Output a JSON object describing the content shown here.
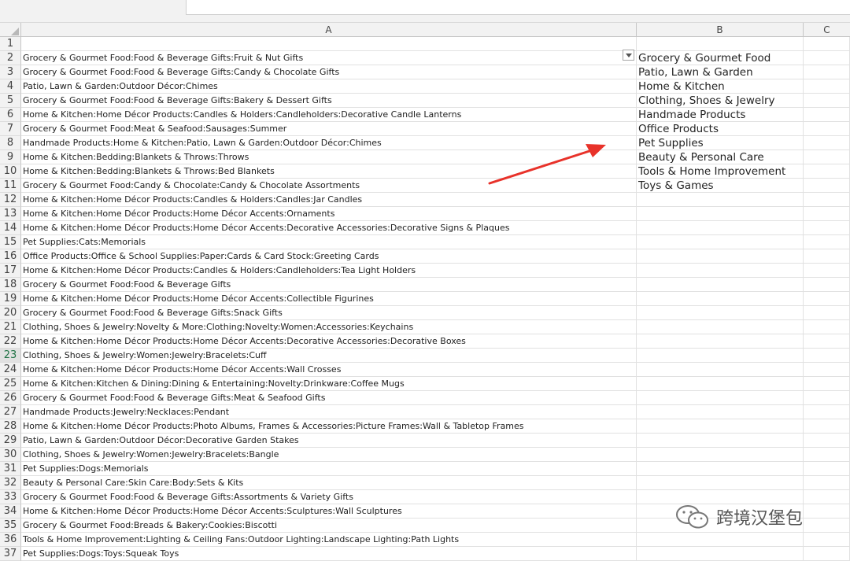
{
  "columns": [
    {
      "label": "A"
    },
    {
      "label": "B"
    },
    {
      "label": "C"
    }
  ],
  "active_row": 23,
  "rows": [
    {
      "n": "1",
      "a": "",
      "b": ""
    },
    {
      "n": "2",
      "a": "Grocery & Gourmet Food:Food & Beverage Gifts:Fruit & Nut Gifts",
      "b": "Grocery & Gourmet Food"
    },
    {
      "n": "3",
      "a": "Grocery & Gourmet Food:Food & Beverage Gifts:Candy & Chocolate Gifts",
      "b": "Patio, Lawn & Garden"
    },
    {
      "n": "4",
      "a": "Patio, Lawn & Garden:Outdoor Décor:Chimes",
      "b": "Home & Kitchen"
    },
    {
      "n": "5",
      "a": "Grocery & Gourmet Food:Food & Beverage Gifts:Bakery & Dessert Gifts",
      "b": "Clothing, Shoes & Jewelry"
    },
    {
      "n": "6",
      "a": "Home & Kitchen:Home Décor Products:Candles & Holders:Candleholders:Decorative Candle Lanterns",
      "b": "Handmade Products"
    },
    {
      "n": "7",
      "a": "Grocery & Gourmet Food:Meat & Seafood:Sausages:Summer",
      "b": "Office Products"
    },
    {
      "n": "8",
      "a": "Handmade Products:Home & Kitchen:Patio, Lawn & Garden:Outdoor Décor:Chimes",
      "b": "Pet Supplies"
    },
    {
      "n": "9",
      "a": "Home & Kitchen:Bedding:Blankets & Throws:Throws",
      "b": "Beauty & Personal Care"
    },
    {
      "n": "10",
      "a": "Home & Kitchen:Bedding:Blankets & Throws:Bed Blankets",
      "b": "Tools & Home Improvement"
    },
    {
      "n": "11",
      "a": "Grocery & Gourmet Food:Candy & Chocolate:Candy & Chocolate Assortments",
      "b": "Toys & Games"
    },
    {
      "n": "12",
      "a": "Home & Kitchen:Home Décor Products:Candles & Holders:Candles:Jar Candles",
      "b": ""
    },
    {
      "n": "13",
      "a": "Home & Kitchen:Home Décor Products:Home Décor Accents:Ornaments",
      "b": ""
    },
    {
      "n": "14",
      "a": "Home & Kitchen:Home Décor Products:Home Décor Accents:Decorative Accessories:Decorative Signs & Plaques",
      "b": ""
    },
    {
      "n": "15",
      "a": "Pet Supplies:Cats:Memorials",
      "b": ""
    },
    {
      "n": "16",
      "a": "Office Products:Office & School Supplies:Paper:Cards & Card Stock:Greeting Cards",
      "b": ""
    },
    {
      "n": "17",
      "a": "Home & Kitchen:Home Décor Products:Candles & Holders:Candleholders:Tea Light Holders",
      "b": ""
    },
    {
      "n": "18",
      "a": "Grocery & Gourmet Food:Food & Beverage Gifts",
      "b": ""
    },
    {
      "n": "19",
      "a": "Home & Kitchen:Home Décor Products:Home Décor Accents:Collectible Figurines",
      "b": ""
    },
    {
      "n": "20",
      "a": "Grocery & Gourmet Food:Food & Beverage Gifts:Snack Gifts",
      "b": ""
    },
    {
      "n": "21",
      "a": "Clothing, Shoes & Jewelry:Novelty & More:Clothing:Novelty:Women:Accessories:Keychains",
      "b": ""
    },
    {
      "n": "22",
      "a": "Home & Kitchen:Home Décor Products:Home Décor Accents:Decorative Accessories:Decorative Boxes",
      "b": ""
    },
    {
      "n": "23",
      "a": "Clothing, Shoes & Jewelry:Women:Jewelry:Bracelets:Cuff",
      "b": ""
    },
    {
      "n": "24",
      "a": "Home & Kitchen:Home Décor Products:Home Décor Accents:Wall Crosses",
      "b": ""
    },
    {
      "n": "25",
      "a": "Home & Kitchen:Kitchen & Dining:Dining & Entertaining:Novelty:Drinkware:Coffee Mugs",
      "b": ""
    },
    {
      "n": "26",
      "a": "Grocery & Gourmet Food:Food & Beverage Gifts:Meat & Seafood Gifts",
      "b": ""
    },
    {
      "n": "27",
      "a": "Handmade Products:Jewelry:Necklaces:Pendant",
      "b": ""
    },
    {
      "n": "28",
      "a": "Home & Kitchen:Home Décor Products:Photo Albums, Frames & Accessories:Picture Frames:Wall & Tabletop Frames",
      "b": ""
    },
    {
      "n": "29",
      "a": "Patio, Lawn & Garden:Outdoor Décor:Decorative Garden Stakes",
      "b": ""
    },
    {
      "n": "30",
      "a": "Clothing, Shoes & Jewelry:Women:Jewelry:Bracelets:Bangle",
      "b": ""
    },
    {
      "n": "31",
      "a": "Pet Supplies:Dogs:Memorials",
      "b": ""
    },
    {
      "n": "32",
      "a": "Beauty & Personal Care:Skin Care:Body:Sets & Kits",
      "b": ""
    },
    {
      "n": "33",
      "a": "Grocery & Gourmet Food:Food & Beverage Gifts:Assortments & Variety Gifts",
      "b": ""
    },
    {
      "n": "34",
      "a": "Home & Kitchen:Home Décor Products:Home Décor Accents:Sculptures:Wall Sculptures",
      "b": ""
    },
    {
      "n": "35",
      "a": "Grocery & Gourmet Food:Breads & Bakery:Cookies:Biscotti",
      "b": ""
    },
    {
      "n": "36",
      "a": "Tools & Home Improvement:Lighting & Ceiling Fans:Outdoor Lighting:Landscape Lighting:Path Lights",
      "b": ""
    },
    {
      "n": "37",
      "a": "Pet Supplies:Dogs:Toys:Squeak Toys",
      "b": ""
    }
  ],
  "filter_icon": "dropdown-arrow-icon",
  "annotation_color": "#e8322a",
  "watermark": {
    "icon": "wechat-icon",
    "text": "跨境汉堡包"
  }
}
